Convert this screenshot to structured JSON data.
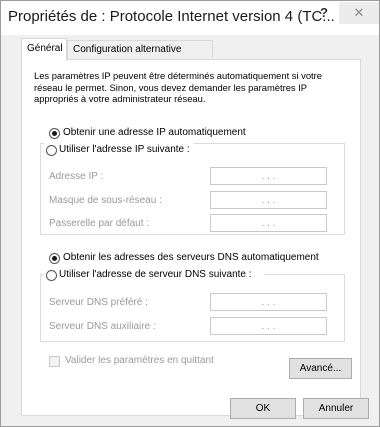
{
  "window": {
    "title": "Propriétés de : Protocole Internet version 4 (TC...",
    "help_glyph": "?",
    "close_glyph": "✕"
  },
  "tabs": [
    {
      "label": "Général",
      "active": true
    },
    {
      "label": "Configuration alternative",
      "active": false
    }
  ],
  "general": {
    "description": "Les paramètres IP peuvent être déterminés automatiquement si votre réseau le permet. Sinon, vous devez demander les paramètres IP appropriés à votre administrateur réseau.",
    "ip": {
      "auto_label": "Obtenir une adresse IP automatiquement",
      "manual_label": "Utiliser l'adresse IP suivante :",
      "selected": "auto",
      "fields": [
        {
          "label": "Adresse IP :",
          "value": ".   .   ."
        },
        {
          "label": "Masque de sous-réseau :",
          "value": ".   .   ."
        },
        {
          "label": "Passerelle par défaut :",
          "value": ".   .   ."
        }
      ]
    },
    "dns": {
      "auto_label": "Obtenir les adresses des serveurs DNS automatiquement",
      "manual_label": "Utiliser l'adresse de serveur DNS suivante :",
      "selected": "auto",
      "fields": [
        {
          "label": "Serveur DNS préféré :",
          "value": ".   .   ."
        },
        {
          "label": "Serveur DNS auxiliaire :",
          "value": ".   .   ."
        }
      ]
    },
    "validate_label": "Valider les paramètres en quittant",
    "validate_checked": false,
    "advanced_label": "Avancé..."
  },
  "footer": {
    "ok_label": "OK",
    "cancel_label": "Annuler"
  }
}
